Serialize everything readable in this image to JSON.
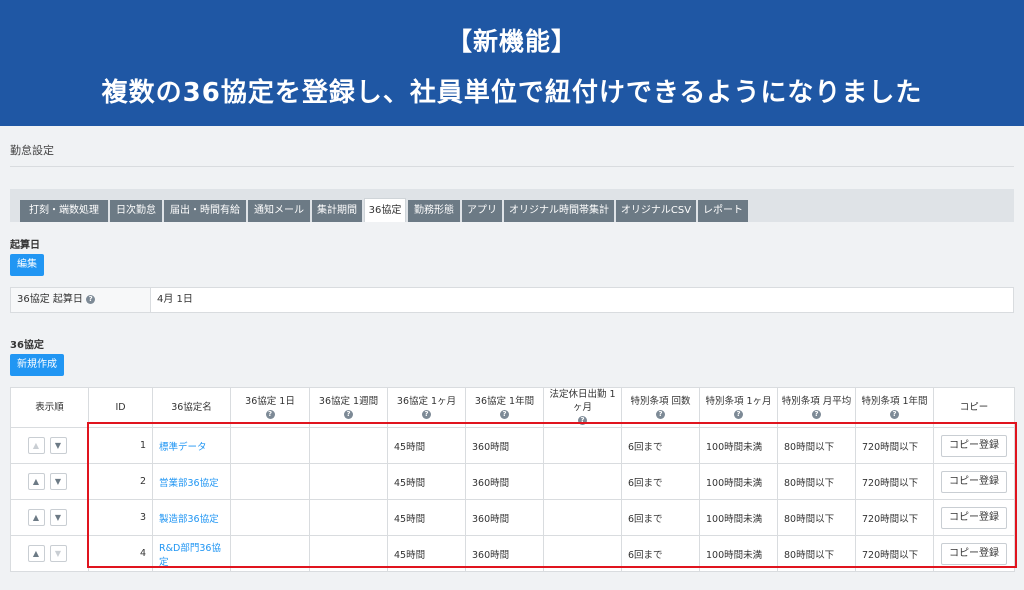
{
  "banner": {
    "line1": "【新機能】",
    "line2": "複数の36協定を登録し、社員単位で紐付けできるようになりました"
  },
  "page": {
    "title": "勤怠設定"
  },
  "tabs": [
    {
      "label": "打刻・端数処理",
      "active": false
    },
    {
      "label": "日次勤怠",
      "active": false
    },
    {
      "label": "届出・時間有給",
      "active": false
    },
    {
      "label": "通知メール",
      "active": false
    },
    {
      "label": "集計期間",
      "active": false
    },
    {
      "label": "36協定",
      "active": true
    },
    {
      "label": "勤務形態",
      "active": false
    },
    {
      "label": "アプリ",
      "active": false
    },
    {
      "label": "オリジナル時間帯集計",
      "active": false
    },
    {
      "label": "オリジナルCSV",
      "active": false
    },
    {
      "label": "レポート",
      "active": false
    }
  ],
  "base_date": {
    "section_label": "起算日",
    "edit_button": "編集",
    "field_label": "36協定 起算日",
    "field_value": "4月 1日"
  },
  "agreements": {
    "section_label": "36協定",
    "new_button": "新規作成",
    "columns": [
      {
        "label": "表示順",
        "help": false
      },
      {
        "label": "ID",
        "help": false
      },
      {
        "label": "36協定名",
        "help": false
      },
      {
        "label": "36協定 1日",
        "help": true
      },
      {
        "label": "36協定 1週間",
        "help": true
      },
      {
        "label": "36協定 1ヶ月",
        "help": true
      },
      {
        "label": "36協定 1年間",
        "help": true
      },
      {
        "label": "法定休日出勤 1ヶ月",
        "help": true
      },
      {
        "label": "特別条項 回数",
        "help": true
      },
      {
        "label": "特別条項 1ヶ月",
        "help": true
      },
      {
        "label": "特別条項 月平均",
        "help": true
      },
      {
        "label": "特別条項 1年間",
        "help": true
      },
      {
        "label": "コピー",
        "help": false
      }
    ],
    "rows": [
      {
        "id": "1",
        "name": "標準データ",
        "day": "",
        "week": "",
        "month": "45時間",
        "year": "360時間",
        "holiday": "",
        "sp_count": "6回まで",
        "sp_month": "100時間未満",
        "sp_avg": "80時間以下",
        "sp_year": "720時間以下",
        "copy": "コピー登録",
        "up_disabled": true,
        "down_disabled": false
      },
      {
        "id": "2",
        "name": "営業部36協定",
        "day": "",
        "week": "",
        "month": "45時間",
        "year": "360時間",
        "holiday": "",
        "sp_count": "6回まで",
        "sp_month": "100時間未満",
        "sp_avg": "80時間以下",
        "sp_year": "720時間以下",
        "copy": "コピー登録",
        "up_disabled": false,
        "down_disabled": false
      },
      {
        "id": "3",
        "name": "製造部36協定",
        "day": "",
        "week": "",
        "month": "45時間",
        "year": "360時間",
        "holiday": "",
        "sp_count": "6回まで",
        "sp_month": "100時間未満",
        "sp_avg": "80時間以下",
        "sp_year": "720時間以下",
        "copy": "コピー登録",
        "up_disabled": false,
        "down_disabled": false
      },
      {
        "id": "4",
        "name": "R&D部門36協定",
        "day": "",
        "week": "",
        "month": "45時間",
        "year": "360時間",
        "holiday": "",
        "sp_count": "6回まで",
        "sp_month": "100時間未満",
        "sp_avg": "80時間以下",
        "sp_year": "720時間以下",
        "copy": "コピー登録",
        "up_disabled": false,
        "down_disabled": true
      }
    ]
  },
  "icons": {
    "help": "question-circle-icon",
    "up": "triangle-up-icon",
    "down": "triangle-down-icon"
  },
  "colors": {
    "banner": "#1f57a4",
    "primary": "#2196f3",
    "tab_inactive": "#6c7a85",
    "highlight": "#e0141e"
  }
}
